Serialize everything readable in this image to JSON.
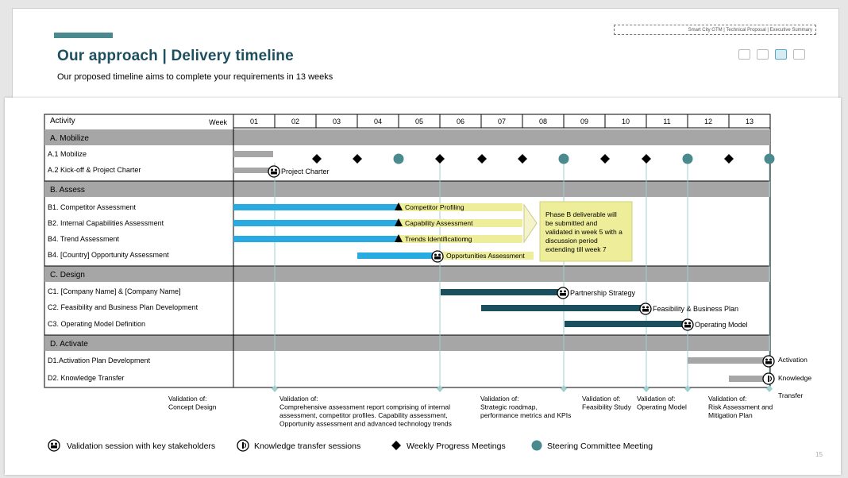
{
  "header": {
    "title": "Our approach | Delivery timeline",
    "subtitle": "Our proposed timeline aims to complete your requirements in 13 weeks",
    "breadcrumb": "Smart City GTM | Technical Proposal | Executive Summary",
    "icons": [
      "folder-icon",
      "document-icon",
      "camera-icon",
      "person-icon"
    ]
  },
  "colors": {
    "title": "#1d4f5f",
    "assess_bar": "#29abe2",
    "design_bar": "#1b4f5e",
    "mobilize_bar": "#a6a6a6",
    "section_bg": "#a6a6a6",
    "teal": "#4a8a8f",
    "callout_bg": "#eeee9a"
  },
  "table": {
    "activity_header": "Activity",
    "week_header": "Week",
    "weeks": [
      "01",
      "02",
      "03",
      "04",
      "05",
      "06",
      "07",
      "08",
      "09",
      "10",
      "11",
      "12",
      "13"
    ]
  },
  "sections": [
    {
      "label": "A. Mobilize"
    },
    {
      "label": "B. Assess"
    },
    {
      "label": "C. Design"
    },
    {
      "label": "D. Activate"
    }
  ],
  "rows": [
    {
      "label": "A.1 Mobilize"
    },
    {
      "label": "A.2 Kick-off & Project Charter"
    },
    {
      "label": "B1. Competitor Assessment"
    },
    {
      "label": "B2. Internal Capabilities Assessment"
    },
    {
      "label": "B4. Trend Assessment"
    },
    {
      "label": "B4. [Country] Opportunity Assessment"
    },
    {
      "label": "C1. [Company Name] & [Company Name]"
    },
    {
      "label": "C2. Feasibility and Business Plan Development"
    },
    {
      "label": "C3. Operating Model Definition"
    },
    {
      "label": "D1.Activation Plan Development"
    },
    {
      "label": "D2. Knowledge Transfer"
    }
  ],
  "bar_labels": {
    "project_charter": "Project Charter",
    "competitor_profiling": "Competitor Profiling",
    "capability_assessment": "Capability Assessment",
    "trends_identification": "Trends Identification",
    "trends_fragment": "ng",
    "opportunities_assessment": "Opportunities Assessment",
    "partnership_strategy": "Partnership Strategy",
    "feasibility_business_plan": "Feasibility & Business Plan",
    "operating_model": "Operating Model",
    "activation": "Activation",
    "knowledge_1": "Knowledge",
    "knowledge_2": "Transfer"
  },
  "callout": {
    "lines": [
      "Phase B deliverable will",
      "be submitted and",
      "validated in week 5 with a",
      "discussion period",
      "extending till week 7"
    ]
  },
  "validations": [
    {
      "lines": [
        "Validation of:",
        "Concept Design"
      ]
    },
    {
      "lines": [
        "Validation of:",
        "Comprehensive assessment report comprising of internal",
        "assessment, competitor profiles. Capability assessment,",
        "Opportunity assessment and advanced technology trends"
      ]
    },
    {
      "lines": [
        "Validation of:",
        "Strategic roadmap,",
        "performance metrics and KPIs"
      ]
    },
    {
      "lines": [
        "Validation of:",
        "Feasibility Study"
      ]
    },
    {
      "lines": [
        "Validation of:",
        "Operating Model"
      ]
    },
    {
      "lines": [
        "Validation of:",
        "Risk Assessment and",
        "Mitigation Plan"
      ]
    }
  ],
  "legend": {
    "validation": "Validation session with key stakeholders",
    "knowledge": "Knowledge transfer sessions",
    "weekly": "Weekly Progress Meetings",
    "steering": "Steering Committee Meeting"
  },
  "page_number": "15"
}
